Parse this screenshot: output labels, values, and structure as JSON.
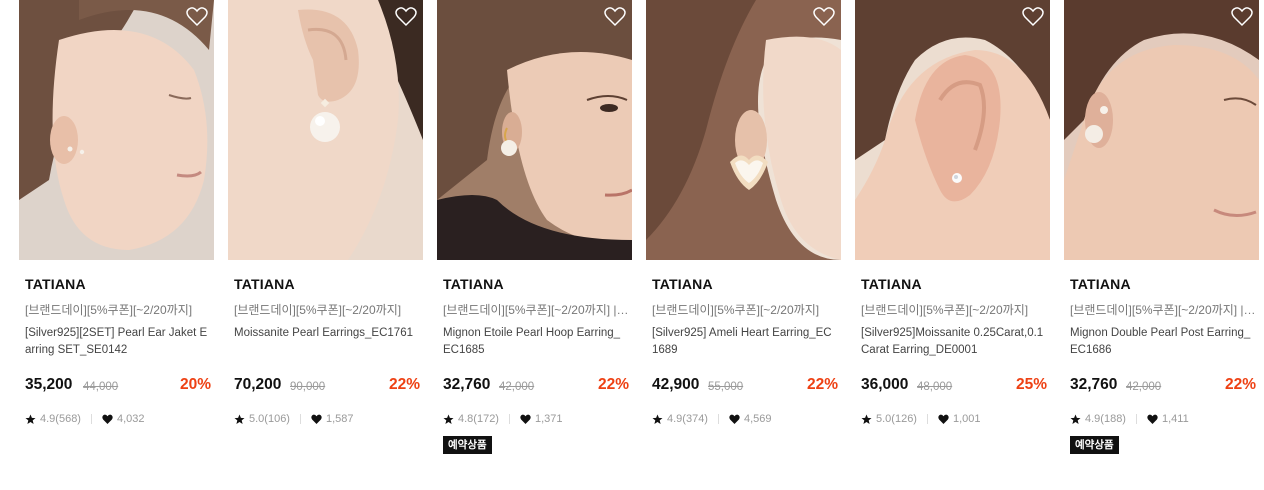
{
  "products": [
    {
      "brand": "TATIANA",
      "promo": "[브랜드데이][5%쿠폰][~2/20까지]",
      "name": "[Silver925][2SET] Pearl Ear Jaket Earring SET_SE0142",
      "price": "35,200",
      "original_price": "44,000",
      "discount": "20%",
      "rating": "4.9(568)",
      "likes": "4,032",
      "badge": ""
    },
    {
      "brand": "TATIANA",
      "promo": "[브랜드데이][5%쿠폰][~2/20까지]",
      "name": "Moissanite Pearl Earrings_EC1761",
      "price": "70,200",
      "original_price": "90,000",
      "discount": "22%",
      "rating": "5.0(106)",
      "likes": "1,587",
      "badge": ""
    },
    {
      "brand": "TATIANA",
      "promo": "[브랜드데이][5%쿠폰][~2/20까지] | [...",
      "name": "Mignon Etoile Pearl Hoop Earring_EC1685",
      "price": "32,760",
      "original_price": "42,000",
      "discount": "22%",
      "rating": "4.8(172)",
      "likes": "1,371",
      "badge": "예약상품"
    },
    {
      "brand": "TATIANA",
      "promo": "[브랜드데이][5%쿠폰][~2/20까지]",
      "name": "[Silver925] Ameli Heart Earring_EC1689",
      "price": "42,900",
      "original_price": "55,000",
      "discount": "22%",
      "rating": "4.9(374)",
      "likes": "4,569",
      "badge": ""
    },
    {
      "brand": "TATIANA",
      "promo": "[브랜드데이][5%쿠폰][~2/20까지]",
      "name": "[Silver925]Moissanite 0.25Carat,0.1Carat Earring_DE0001",
      "price": "36,000",
      "original_price": "48,000",
      "discount": "25%",
      "rating": "5.0(126)",
      "likes": "1,001",
      "badge": ""
    },
    {
      "brand": "TATIANA",
      "promo": "[브랜드데이][5%쿠폰][~2/20까지] | [...",
      "name": "Mignon Double Pearl Post Earring_EC1686",
      "price": "32,760",
      "original_price": "42,000",
      "discount": "22%",
      "rating": "4.9(188)",
      "likes": "1,411",
      "badge": "예약상품"
    }
  ],
  "colors": {
    "discount": "#ee4114",
    "badge_bg": "#111111",
    "muted_text": "#9a9a9a"
  },
  "icons": {
    "wishlist": "heart-outline-icon",
    "rating": "star-icon",
    "likes": "heart-filled-icon"
  }
}
